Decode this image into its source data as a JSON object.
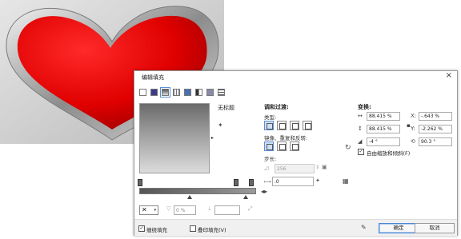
{
  "colors": {
    "heart_red": "#e00000",
    "heart_dark": "#a80000",
    "frame_gray": "#9a9a9a",
    "background_gray": "#cdcdcd",
    "accent_blue": "#4a87d4"
  },
  "dialog": {
    "title": "编辑填充",
    "close_glyph": "×",
    "fill_types": [
      {
        "icon": "no-fill-icon"
      },
      {
        "icon": "uniform-fill-icon"
      },
      {
        "icon": "fountain-fill-icon",
        "selected": true
      },
      {
        "icon": "vector-pattern-icon"
      },
      {
        "icon": "bitmap-pattern-icon"
      },
      {
        "icon": "two-color-pattern-icon"
      },
      {
        "icon": "texture-fill-icon"
      },
      {
        "icon": "postscript-fill-icon"
      }
    ],
    "preset_name": "无标题",
    "gear_glyph": "✦",
    "dropdown_glyph": "▸",
    "color_picker_glyph": "✕",
    "color_picker_arrow": "▾",
    "transparency_value": "0 %",
    "position_value": "",
    "blend": {
      "title": "调和过渡:",
      "type_label": "类型:",
      "mirror_label": "镜像、重复和反转:",
      "steps_label": "步长:",
      "steps_value": "256",
      "accel_label": "",
      "accel_value": ".0"
    },
    "transform": {
      "title": "变换:",
      "width": "88.415 %",
      "height": "88.415 %",
      "x": "-.643 %",
      "y": "-2.262 %",
      "skew": "-4 °",
      "rotate": "90.3 °",
      "x_label": "X:",
      "y_label": "Y:",
      "free_scale_label": "自由缩放和倾斜(F)",
      "free_scale_checked": true
    },
    "footer": {
      "wrap_label": "缠绕填充",
      "wrap_checked": true,
      "overprint_label": "叠印填充(V)",
      "overprint_checked": false,
      "ok_label": "确定",
      "cancel_label": "取消"
    }
  }
}
